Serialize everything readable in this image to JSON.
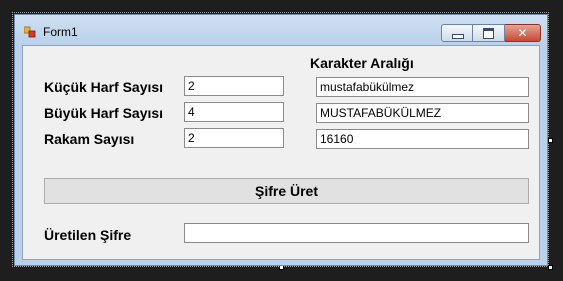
{
  "window": {
    "title": "Form1",
    "minimize_icon": "minimize-icon",
    "maximize_icon": "maximize-icon",
    "close_icon": "close-icon",
    "app_icon": "form-icon"
  },
  "labels": {
    "range_header": "Karakter Aralığı",
    "lowercase": "Küçük Harf Sayısı",
    "uppercase": "Büyük Harf Sayısı",
    "digits": "Rakam Sayısı",
    "result": "Üretilen Şifre"
  },
  "inputs": {
    "lowercase_count": "2",
    "uppercase_count": "4",
    "digit_count": "2",
    "lowercase_chars": "mustafabükülmez",
    "uppercase_chars": "MUSTAFABÜKÜLMEZ",
    "digit_chars": "16160",
    "generated_password": ""
  },
  "buttons": {
    "generate": "Şifre Üret"
  }
}
